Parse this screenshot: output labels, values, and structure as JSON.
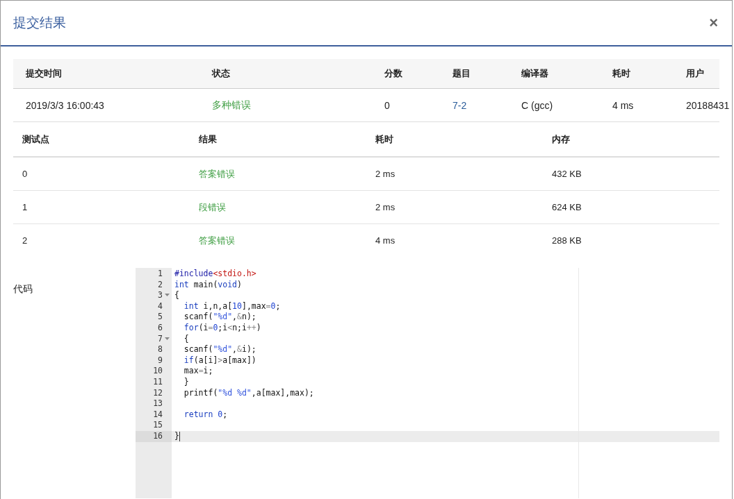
{
  "dialog": {
    "title": "提交结果",
    "close": "×"
  },
  "submission": {
    "columns": [
      "提交时间",
      "状态",
      "分数",
      "题目",
      "编译器",
      "耗时",
      "用户"
    ],
    "row": [
      {
        "text": "2019/3/3 16:00:43",
        "kind": "plain"
      },
      {
        "text": "多种错误",
        "kind": "status"
      },
      {
        "text": "0",
        "kind": "plain"
      },
      {
        "text": "7-2",
        "kind": "link"
      },
      {
        "text": "C (gcc)",
        "kind": "plain"
      },
      {
        "text": "4 ms",
        "kind": "plain"
      },
      {
        "text": "20188431",
        "kind": "plain"
      }
    ]
  },
  "tests": {
    "columns": [
      "测试点",
      "结果",
      "耗时",
      "内存"
    ],
    "rows": [
      {
        "cells": [
          "0",
          "答案错误",
          "2 ms",
          "432 KB"
        ]
      },
      {
        "cells": [
          "1",
          "段错误",
          "2 ms",
          "624 KB"
        ]
      },
      {
        "cells": [
          "2",
          "答案错误",
          "4 ms",
          "288 KB"
        ]
      }
    ]
  },
  "code": {
    "label": "代码",
    "lines": [
      {
        "number": "1",
        "foldable": false,
        "active": false,
        "tokens": [
          {
            "t": "#include",
            "kind": "meta"
          },
          {
            "t": "<stdio.h>",
            "kind": "header"
          }
        ]
      },
      {
        "number": "2",
        "foldable": false,
        "active": false,
        "tokens": [
          {
            "t": "int",
            "kind": "keyword"
          },
          {
            "t": " main(",
            "kind": "plain"
          },
          {
            "t": "void",
            "kind": "keyword"
          },
          {
            "t": ")",
            "kind": "plain"
          }
        ]
      },
      {
        "number": "3",
        "foldable": true,
        "active": false,
        "tokens": [
          {
            "t": "{",
            "kind": "plain"
          }
        ]
      },
      {
        "number": "4",
        "foldable": false,
        "active": false,
        "tokens": [
          {
            "t": "  int",
            "kind": "keyword"
          },
          {
            "t": " i,n,a[",
            "kind": "plain"
          },
          {
            "t": "10",
            "kind": "number"
          },
          {
            "t": "],max",
            "kind": "plain"
          },
          {
            "t": "=",
            "kind": "operator"
          },
          {
            "t": "0",
            "kind": "number"
          },
          {
            "t": ";",
            "kind": "plain"
          }
        ]
      },
      {
        "number": "5",
        "foldable": false,
        "active": false,
        "tokens": [
          {
            "t": "  scanf(",
            "kind": "plain"
          },
          {
            "t": "\"%d\"",
            "kind": "string"
          },
          {
            "t": ",",
            "kind": "plain"
          },
          {
            "t": "&",
            "kind": "operator"
          },
          {
            "t": "n);",
            "kind": "plain"
          }
        ]
      },
      {
        "number": "6",
        "foldable": false,
        "active": false,
        "tokens": [
          {
            "t": "  for",
            "kind": "keyword"
          },
          {
            "t": "(i",
            "kind": "plain"
          },
          {
            "t": "=",
            "kind": "operator"
          },
          {
            "t": "0",
            "kind": "number"
          },
          {
            "t": ";i",
            "kind": "plain"
          },
          {
            "t": "<",
            "kind": "operator"
          },
          {
            "t": "n;i",
            "kind": "plain"
          },
          {
            "t": "++",
            "kind": "operator"
          },
          {
            "t": ")",
            "kind": "plain"
          }
        ]
      },
      {
        "number": "7",
        "foldable": true,
        "active": false,
        "tokens": [
          {
            "t": "  {",
            "kind": "plain"
          }
        ]
      },
      {
        "number": "8",
        "foldable": false,
        "active": false,
        "tokens": [
          {
            "t": "  scanf(",
            "kind": "plain"
          },
          {
            "t": "\"%d\"",
            "kind": "string"
          },
          {
            "t": ",",
            "kind": "plain"
          },
          {
            "t": "&",
            "kind": "operator"
          },
          {
            "t": "i);",
            "kind": "plain"
          }
        ]
      },
      {
        "number": "9",
        "foldable": false,
        "active": false,
        "tokens": [
          {
            "t": "  if",
            "kind": "keyword"
          },
          {
            "t": "(a[i]",
            "kind": "plain"
          },
          {
            "t": ">",
            "kind": "operator"
          },
          {
            "t": "a[max])",
            "kind": "plain"
          }
        ]
      },
      {
        "number": "10",
        "foldable": false,
        "active": false,
        "tokens": [
          {
            "t": "  max",
            "kind": "plain"
          },
          {
            "t": "=",
            "kind": "operator"
          },
          {
            "t": "i;",
            "kind": "plain"
          }
        ]
      },
      {
        "number": "11",
        "foldable": false,
        "active": false,
        "tokens": [
          {
            "t": "  }",
            "kind": "plain"
          }
        ]
      },
      {
        "number": "12",
        "foldable": false,
        "active": false,
        "tokens": [
          {
            "t": "  printf(",
            "kind": "plain"
          },
          {
            "t": "\"%d %d\"",
            "kind": "string"
          },
          {
            "t": ",a[max],max);",
            "kind": "plain"
          }
        ]
      },
      {
        "number": "13",
        "foldable": false,
        "active": false
      },
      {
        "number": "14",
        "foldable": false,
        "active": false,
        "tokens": [
          {
            "t": "  return",
            "kind": "keyword"
          },
          {
            "t": " 0",
            "kind": "number"
          },
          {
            "t": ";",
            "kind": "plain"
          }
        ]
      },
      {
        "number": "15",
        "foldable": false,
        "active": false
      },
      {
        "number": "16",
        "foldable": false,
        "active": true,
        "tokens": [
          {
            "t": "}",
            "kind": "plain"
          }
        ]
      }
    ]
  }
}
